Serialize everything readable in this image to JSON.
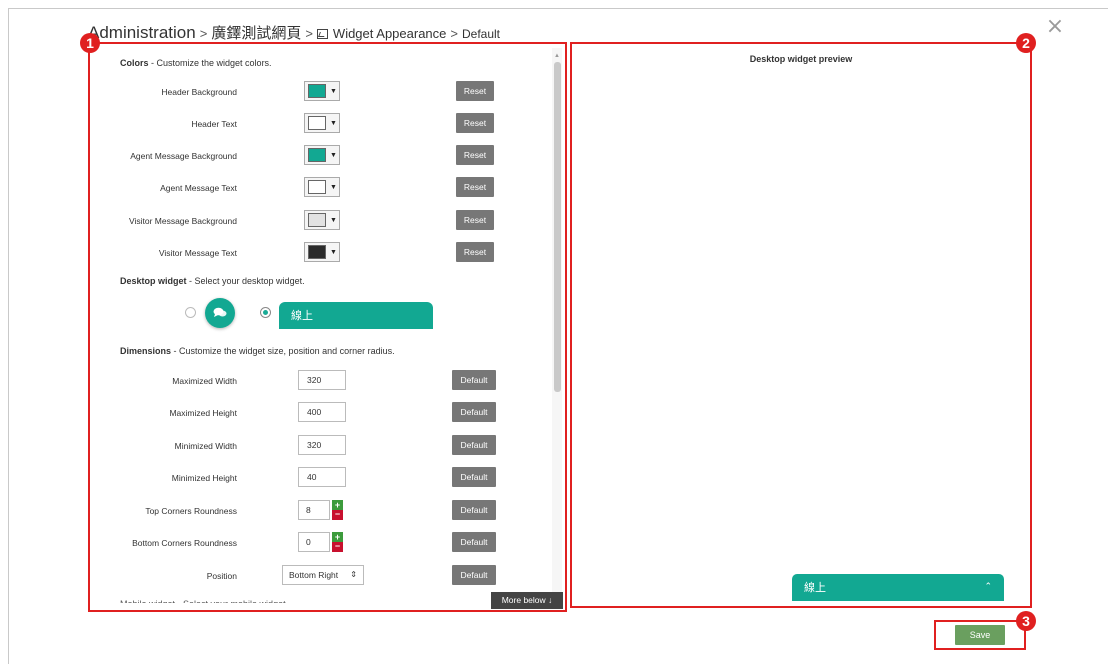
{
  "breadcrumb": {
    "root": "Administration",
    "sep": ">",
    "site": "廣鐸測試網頁",
    "widget": "Widget Appearance",
    "last": "Default"
  },
  "annotations": {
    "one": "1",
    "two": "2",
    "three": "3"
  },
  "colors": {
    "title": "Colors",
    "description": " - Customize the widget colors.",
    "reset_label": "Reset",
    "rows": [
      {
        "label": "Header Background",
        "swatch": "#12a892"
      },
      {
        "label": "Header Text",
        "swatch": "#ffffff"
      },
      {
        "label": "Agent Message Background",
        "swatch": "#12a892"
      },
      {
        "label": "Agent Message Text",
        "swatch": "#ffffff"
      },
      {
        "label": "Visitor Message Background",
        "swatch": "#e2e2e2"
      },
      {
        "label": "Visitor Message Text",
        "swatch": "#2b2b2b"
      }
    ]
  },
  "desktop_widget": {
    "title": "Desktop widget",
    "description": " - Select your desktop widget.",
    "bar_label": "線上",
    "selected": "bar"
  },
  "dimensions": {
    "title": "Dimensions",
    "description": " - Customize the widget size, position and corner radius.",
    "default_label": "Default",
    "max_width": {
      "label": "Maximized Width",
      "value": "320"
    },
    "max_height": {
      "label": "Maximized Height",
      "value": "400"
    },
    "min_width": {
      "label": "Minimized Width",
      "value": "320"
    },
    "min_height": {
      "label": "Minimized Height",
      "value": "40"
    },
    "top_corners": {
      "label": "Top Corners Roundness",
      "value": "8"
    },
    "bottom_corners": {
      "label": "Bottom Corners Roundness",
      "value": "0"
    },
    "position": {
      "label": "Position",
      "value": "Bottom Right",
      "arrow": "⇕"
    }
  },
  "mobile_widget_cutoff": "Mobile widget - Select your mobile widget",
  "more_below": "More below ↓",
  "preview": {
    "title": "Desktop widget preview",
    "widget_label": "線上",
    "chevron": "⌃"
  },
  "save_label": "Save",
  "accent": "#12a892",
  "annotation_color": "#e02020"
}
